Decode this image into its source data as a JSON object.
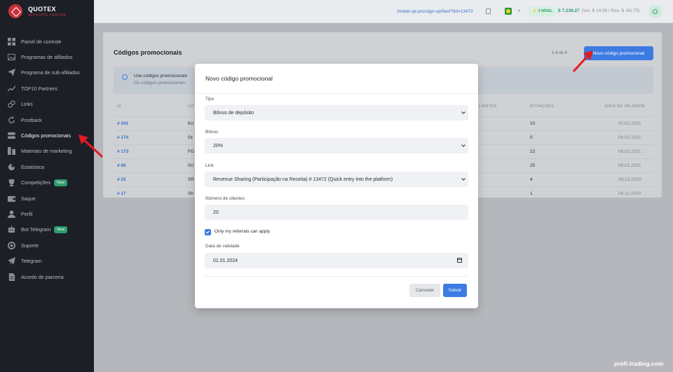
{
  "app": {
    "title": "QUOTEX",
    "subtitle": "AFFILIATE CENTER"
  },
  "sidebar": {
    "items": [
      {
        "label": "Painel de controle",
        "icon": "dashboard-icon"
      },
      {
        "label": "Programas de afiliados",
        "icon": "image-icon"
      },
      {
        "label": "Programa de sub-afiliados",
        "icon": "send-icon"
      },
      {
        "label": "TOP10 Partners",
        "icon": "trend-icon"
      },
      {
        "label": "Links",
        "icon": "link-icon"
      },
      {
        "label": "Postback",
        "icon": "refresh-icon"
      },
      {
        "label": "Códigos promocionais",
        "icon": "toggle-icon"
      },
      {
        "label": "Materiais de marketing",
        "icon": "marketing-icon"
      },
      {
        "label": "Estatística",
        "icon": "chart-icon"
      },
      {
        "label": "Competições",
        "icon": "trophy-icon",
        "badge": "New"
      },
      {
        "label": "Saque",
        "icon": "wallet-icon"
      },
      {
        "label": "Perfil",
        "icon": "user-icon"
      },
      {
        "label": "Bot Telegram",
        "icon": "bot-icon",
        "badge": "New"
      },
      {
        "label": "Suporte",
        "icon": "support-icon"
      },
      {
        "label": "Telegram",
        "icon": "telegram-icon"
      },
      {
        "label": "Acordo de parceria",
        "icon": "document-icon"
      }
    ]
  },
  "topbar": {
    "link": "broker-qx.pro/sign-up/fast/?lid=13472",
    "level": "3 NÍVEL",
    "balance": "$ 7,238.27",
    "balance_detail": "(Vol. $ 14.08 / Rev. $ -64.75)"
  },
  "page": {
    "title": "Códigos promocionais",
    "pager": "1-6 de 6",
    "new_button": "Novo código promocional",
    "info_line1": "Use códigos promocionais",
    "info_line2": "Os códigos promocionais",
    "columns": {
      "id": "ID",
      "code": "CÓ",
      "clients": "LIENTES",
      "activations": "ATIVAÇÕES",
      "validity": "DATA DE VALIDADE"
    },
    "rows": [
      {
        "id": "# 341",
        "code": "Kn",
        "activations": "10",
        "date": "02.02.2021"
      },
      {
        "id": "# 174",
        "code": "0z",
        "activations": "0",
        "date": "06.02.2021"
      },
      {
        "id": "# 173",
        "code": "FG",
        "activations": "22",
        "date": "06.02.2021"
      },
      {
        "id": "# 60",
        "code": "0U",
        "activations": "25",
        "date": "06.01.2021"
      },
      {
        "id": "# 25",
        "code": "SR",
        "activations": "4",
        "date": "09.12.2020"
      },
      {
        "id": "# 17",
        "code": "Sh",
        "activations": "1",
        "date": "08.11.2020"
      }
    ]
  },
  "modal": {
    "title": "Novo código promocional",
    "type_label": "Tipo",
    "type_value": "Bônus de depósito",
    "bonus_label": "Bônus",
    "bonus_value": "20%",
    "link_label": "Link",
    "link_value": "Revenue Sharing (Participação na Receita) # 13472 (Quick entry into the platform)",
    "clients_label": "Número de clientes",
    "clients_value": "20",
    "checkbox_label": "Only my referrals can apply",
    "checkbox_checked": true,
    "date_label": "Data de validade",
    "date_value": "01.01.2024",
    "cancel": "Cancelar",
    "save": "Salvar"
  },
  "watermark": "profi-trading.com",
  "colors": {
    "accent": "#3d7be3",
    "brand": "#c8313a",
    "success": "#2e9d6e",
    "arrow": "#e21b23"
  }
}
